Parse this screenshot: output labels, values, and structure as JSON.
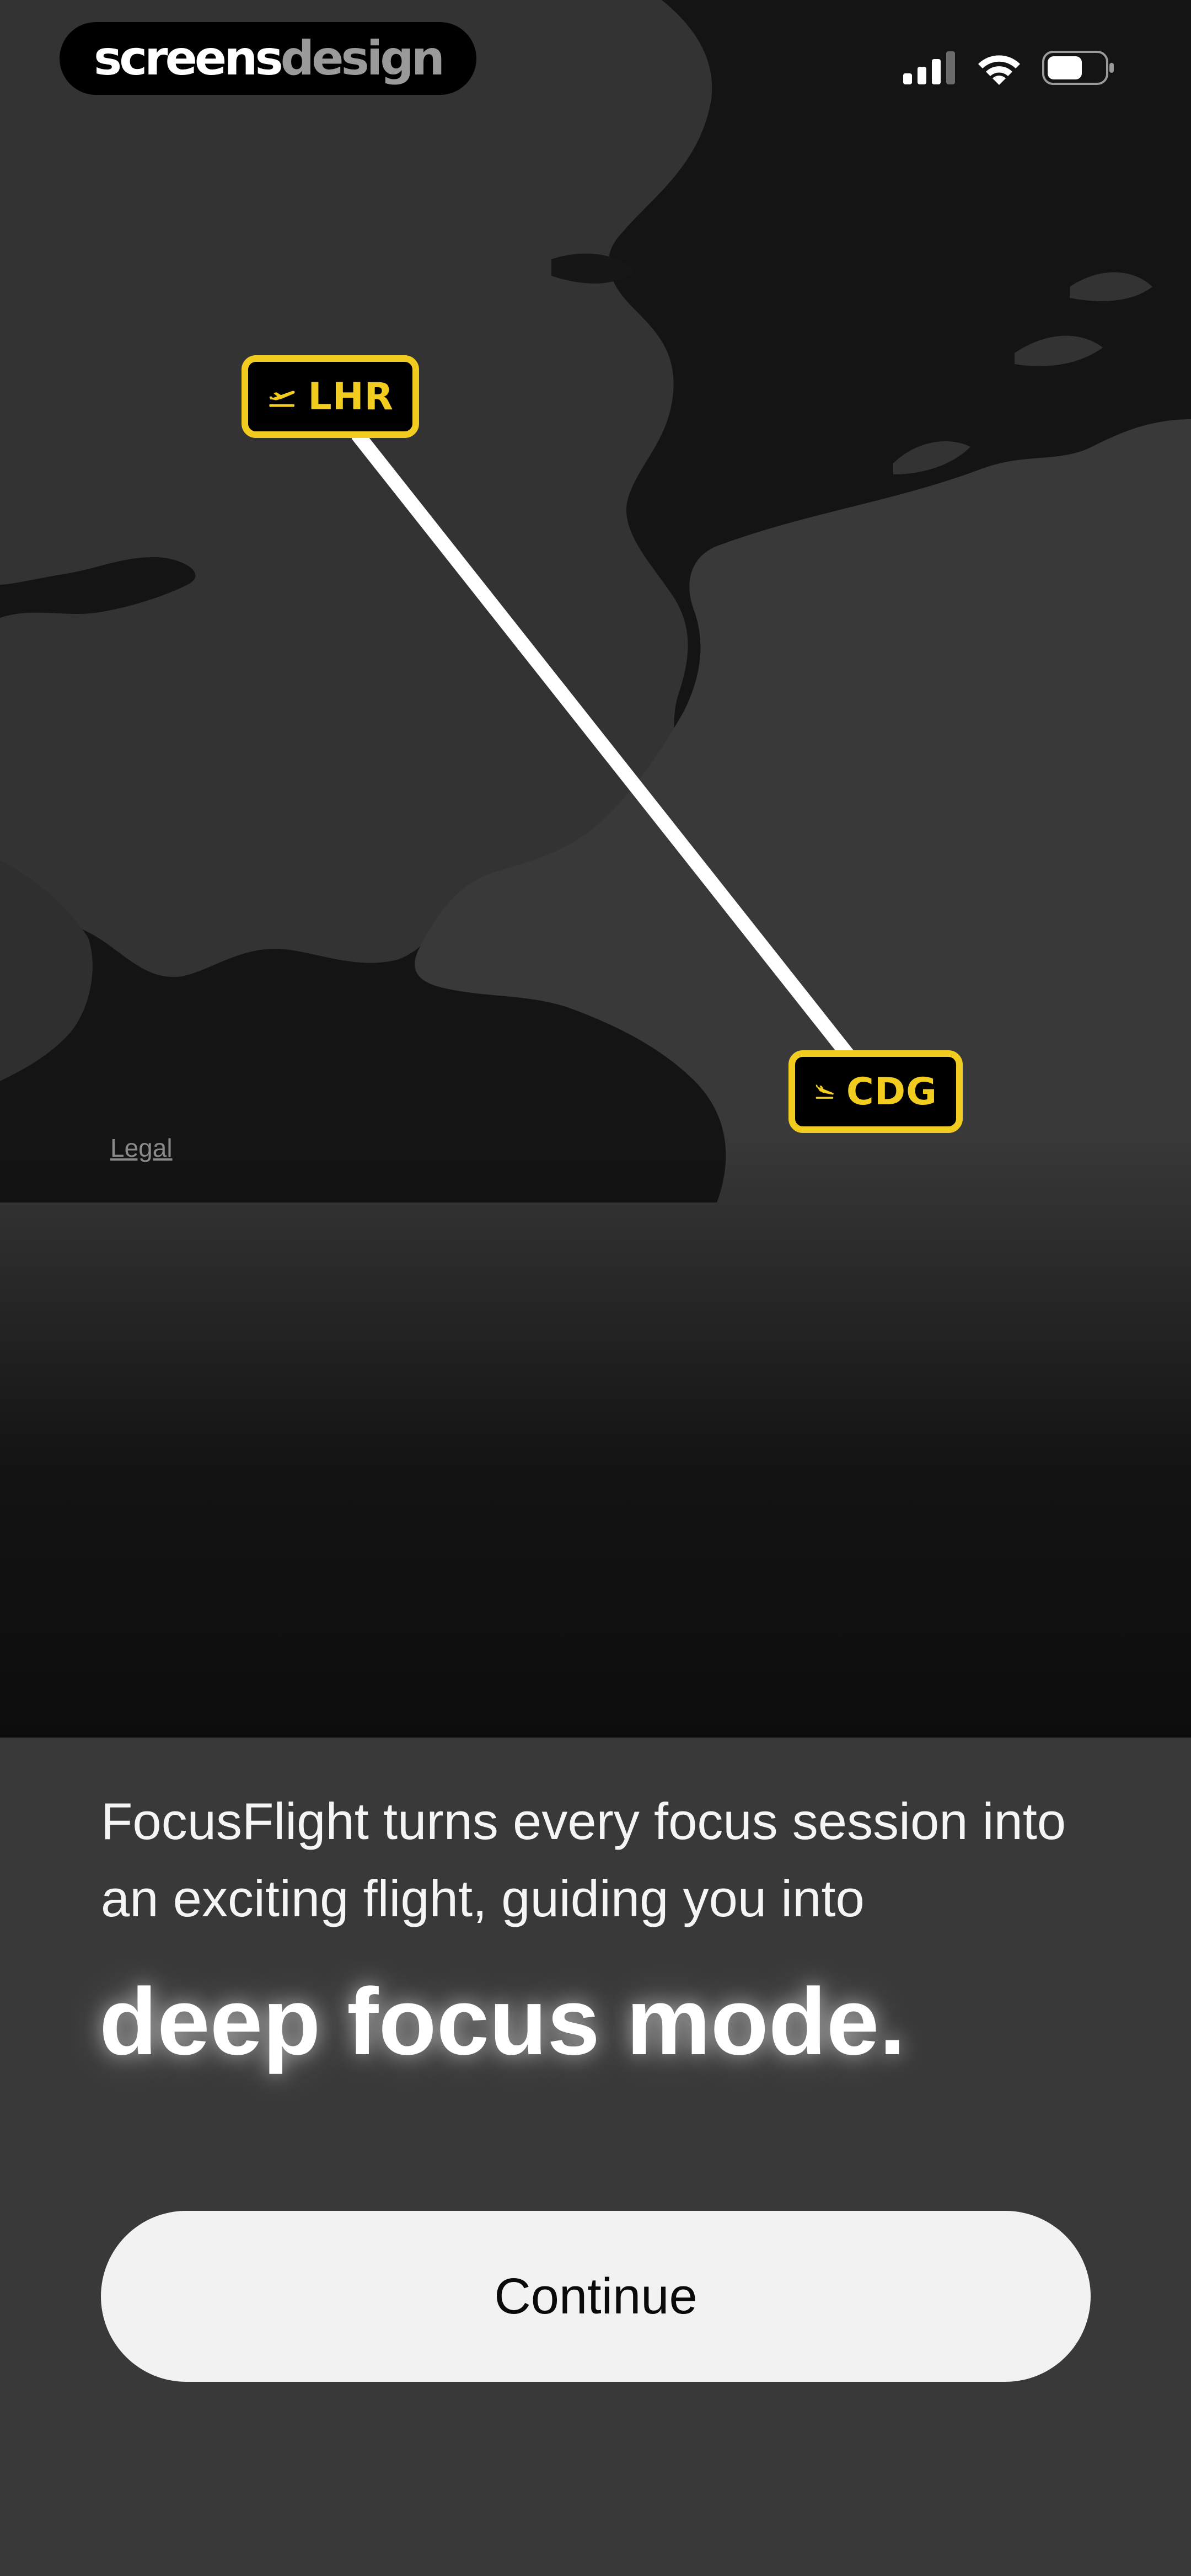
{
  "brand": {
    "part1": "screens",
    "part2": "design"
  },
  "status_bar": {
    "icons": [
      "cellular-signal-icon",
      "wifi-icon",
      "battery-icon"
    ]
  },
  "map": {
    "legal_label": "Legal",
    "origin": {
      "code": "LHR",
      "icon": "plane-takeoff-icon"
    },
    "destination": {
      "code": "CDG",
      "icon": "plane-landing-icon"
    }
  },
  "onboarding": {
    "intro_text": "FocusFlight turns every focus session into an exciting flight, guiding you into",
    "headline": "deep focus mode.",
    "continue_label": "Continue"
  },
  "colors": {
    "accent_yellow": "#f2cd1f",
    "background": "#0d0d0d",
    "land": "#353535",
    "sea": "#161616",
    "button_bg": "#f2f2f2"
  }
}
